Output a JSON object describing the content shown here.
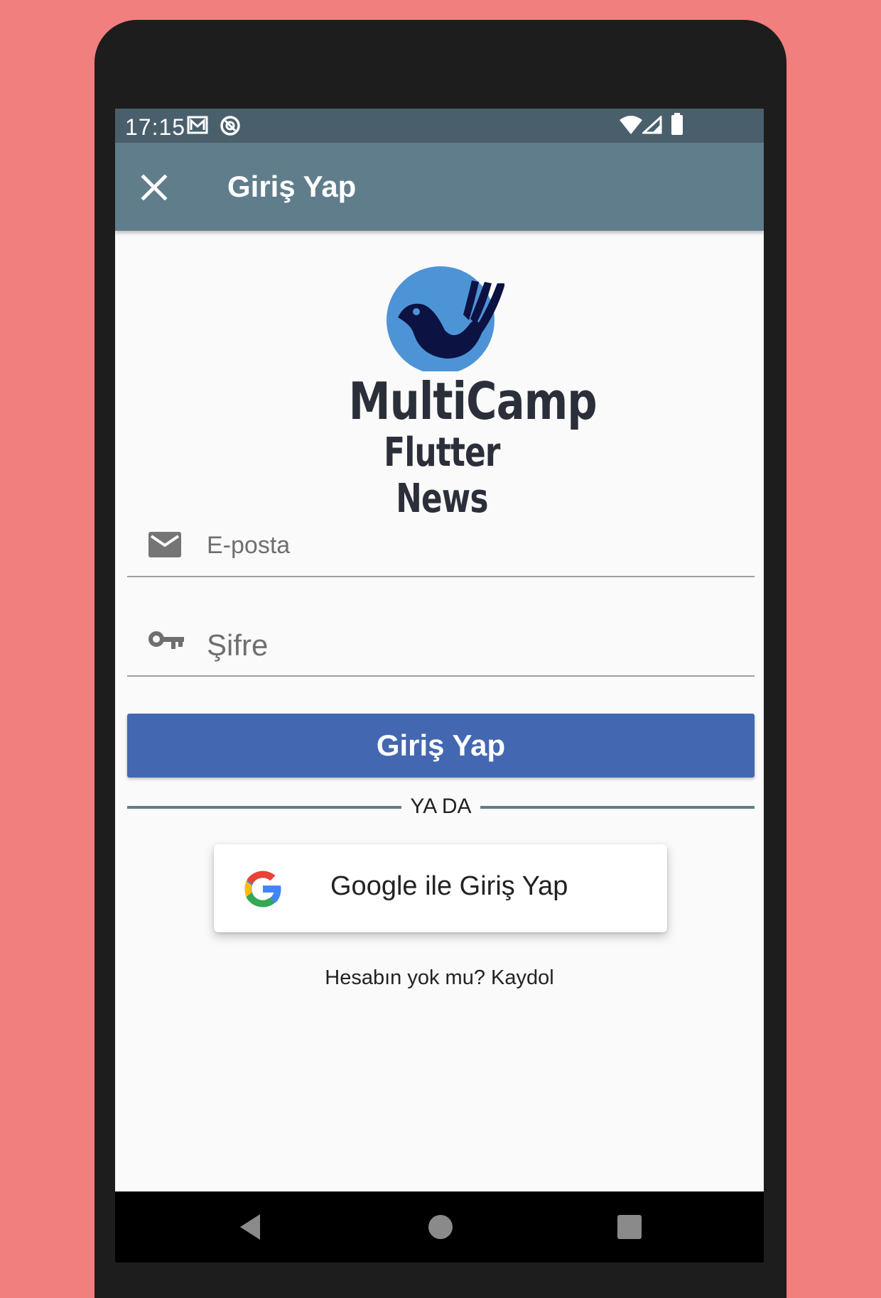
{
  "status_bar": {
    "time": "17:15",
    "left_icons": [
      "gmail-icon",
      "sync-icon"
    ],
    "right_icons": [
      "wifi-icon",
      "signal-icon",
      "battery-icon"
    ]
  },
  "app_bar": {
    "title": "Giriş Yap",
    "close_icon": "close-icon"
  },
  "logo": {
    "title": "MultiCamp",
    "subtitle": "Flutter News"
  },
  "form": {
    "email": {
      "placeholder": "E-posta",
      "icon": "mail-icon",
      "value": ""
    },
    "password": {
      "placeholder": "Şifre",
      "icon": "key-icon",
      "value": ""
    },
    "login_button": "Giriş Yap"
  },
  "divider": {
    "label": "YA DA"
  },
  "google_button": {
    "label": "Google ile Giriş Yap",
    "icon": "google-icon"
  },
  "signup": {
    "label": "Hesabın yok mu? Kaydol"
  },
  "nav_bar": [
    "back-icon",
    "home-icon",
    "recents-icon"
  ],
  "colors": {
    "background": "#f07f7e",
    "status_bar": "#4a5f6c",
    "app_bar": "#607d8b",
    "primary_button": "#4467b1",
    "divider_line": "#607d8b",
    "logo_circle": "#4d94d6",
    "logo_bird": "#0c1242"
  }
}
